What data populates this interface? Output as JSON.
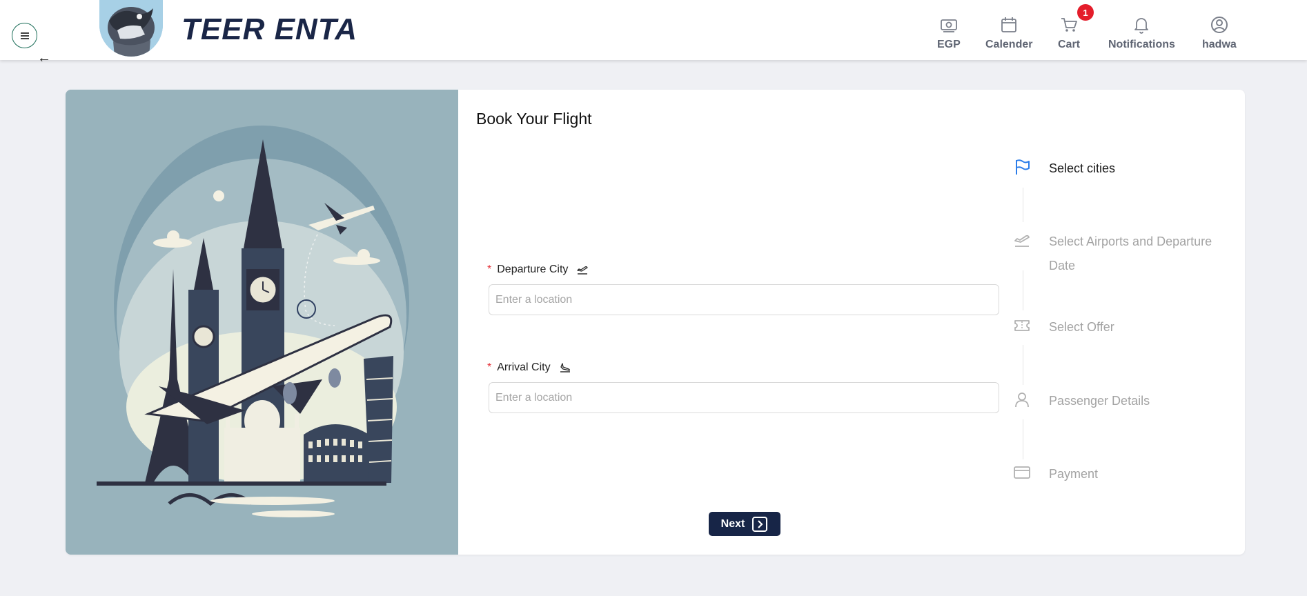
{
  "header": {
    "brand": "TEER ENTA",
    "nav": [
      {
        "label": "EGP",
        "icon": "currency-icon"
      },
      {
        "label": "Calender",
        "icon": "calendar-icon"
      },
      {
        "label": "Cart",
        "icon": "cart-icon",
        "badge": "1"
      },
      {
        "label": "Notifications",
        "icon": "bell-icon"
      },
      {
        "label": "hadwa",
        "icon": "user-circle-icon"
      }
    ]
  },
  "back_label": "←",
  "form": {
    "title": "Book Your Flight",
    "departure": {
      "label": "Departure City",
      "placeholder": "Enter a location",
      "required_mark": "*"
    },
    "arrival": {
      "label": "Arrival City",
      "placeholder": "Enter a location",
      "required_mark": "*"
    },
    "next_label": "Next"
  },
  "steps": [
    {
      "label": "Select cities",
      "icon": "flag-icon",
      "active": true
    },
    {
      "label": "Select Airports and Departure Date",
      "icon": "plane-takeoff-icon",
      "active": false
    },
    {
      "label": "Select Offer",
      "icon": "ticket-icon",
      "active": false
    },
    {
      "label": "Passenger Details",
      "icon": "user-icon",
      "active": false
    },
    {
      "label": "Payment",
      "icon": "credit-card-icon",
      "active": false
    }
  ],
  "colors": {
    "brand": "#1a2647",
    "active_step": "#2b7de9",
    "badge": "#e41d2b",
    "button": "#172547"
  }
}
